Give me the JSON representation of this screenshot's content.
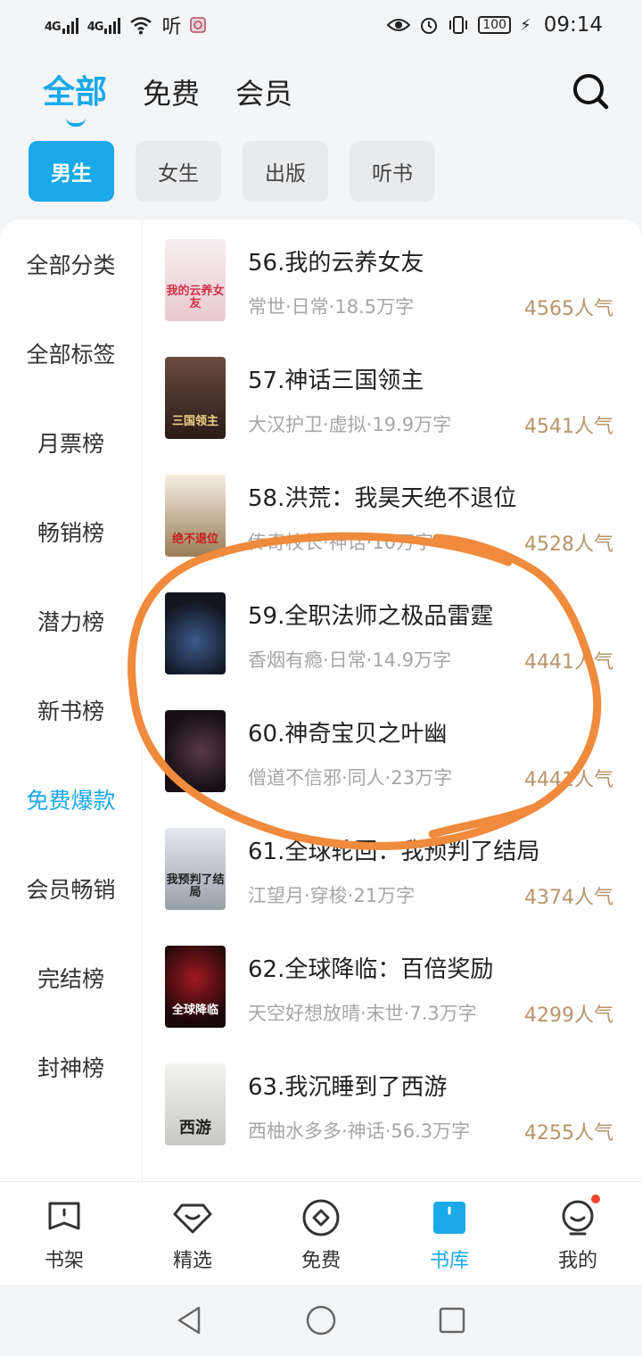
{
  "status": {
    "net1": "4G",
    "net2": "4G",
    "app_icon": "听",
    "battery": "100",
    "time": "09:14"
  },
  "top_tabs": [
    {
      "label": "全部",
      "active": true
    },
    {
      "label": "免费",
      "active": false
    },
    {
      "label": "会员",
      "active": false
    }
  ],
  "chips": [
    {
      "label": "男生",
      "active": true
    },
    {
      "label": "女生",
      "active": false
    },
    {
      "label": "出版",
      "active": false
    },
    {
      "label": "听书",
      "active": false
    }
  ],
  "sidebar": [
    {
      "label": "全部分类"
    },
    {
      "label": "全部标签"
    },
    {
      "label": "月票榜"
    },
    {
      "label": "畅销榜"
    },
    {
      "label": "潜力榜"
    },
    {
      "label": "新书榜"
    },
    {
      "label": "免费爆款",
      "active": true
    },
    {
      "label": "会员畅销"
    },
    {
      "label": "完结榜"
    },
    {
      "label": "封神榜"
    }
  ],
  "books": [
    {
      "title": "56.我的云养女友",
      "meta": "常世·日常·18.5万字",
      "popularity": "4565人气",
      "cover_color": "#f2e6e8",
      "cover_text": "我的云养女友",
      "cover_text_color": "#d2314a"
    },
    {
      "title": "57.神话三国领主",
      "meta": "大汉护卫·虚拟·19.9万字",
      "popularity": "4541人气",
      "cover_color": "#3b2a25",
      "cover_text": "三国领主",
      "cover_text_color": "#f1d48a"
    },
    {
      "title": "58.洪荒：我昊天绝不退位",
      "meta": "传奇校长·神话·10万字",
      "popularity": "4528人气",
      "cover_color": "#efe8da",
      "cover_text": "绝不退位",
      "cover_text_color": "#c8201e"
    },
    {
      "title": "59.全职法师之极品雷霆",
      "meta": "香烟有瘾·日常·14.9万字",
      "popularity": "4441人气",
      "cover_color": "#1c2233",
      "cover_text": "",
      "cover_text_color": "#ffffff"
    },
    {
      "title": "60.神奇宝贝之叶幽",
      "meta": "僧道不信邪·同人·23万字",
      "popularity": "4441人气",
      "cover_color": "#221a22",
      "cover_text": "",
      "cover_text_color": "#ffffff"
    },
    {
      "title": "61.全球轮回：我预判了结局",
      "meta": "江望月·穿梭·21万字",
      "popularity": "4374人气",
      "cover_color": "#d9dde2",
      "cover_text": "我预判了结局",
      "cover_text_color": "#222222"
    },
    {
      "title": "62.全球降临：百倍奖励",
      "meta": "天空好想放晴·末世·7.3万字",
      "popularity": "4299人气",
      "cover_color": "#2a0d0f",
      "cover_text": "全球降临",
      "cover_text_color": "#ffffff"
    },
    {
      "title": "63.我沉睡到了西游",
      "meta": "西柚水多多·神话·56.3万字",
      "popularity": "4255人气",
      "cover_color": "#f0f0ee",
      "cover_text": "西游",
      "cover_text_color": "#222222"
    }
  ],
  "bottom_nav": [
    {
      "label": "书架",
      "icon": "bookshelf-icon"
    },
    {
      "label": "精选",
      "icon": "gem-icon"
    },
    {
      "label": "免费",
      "icon": "free-icon"
    },
    {
      "label": "书库",
      "icon": "library-icon",
      "active": true
    },
    {
      "label": "我的",
      "icon": "profile-icon"
    }
  ],
  "colors": {
    "accent": "#1aa9e9",
    "popularity": "#b8946a",
    "annotation": "#f08a3c"
  }
}
